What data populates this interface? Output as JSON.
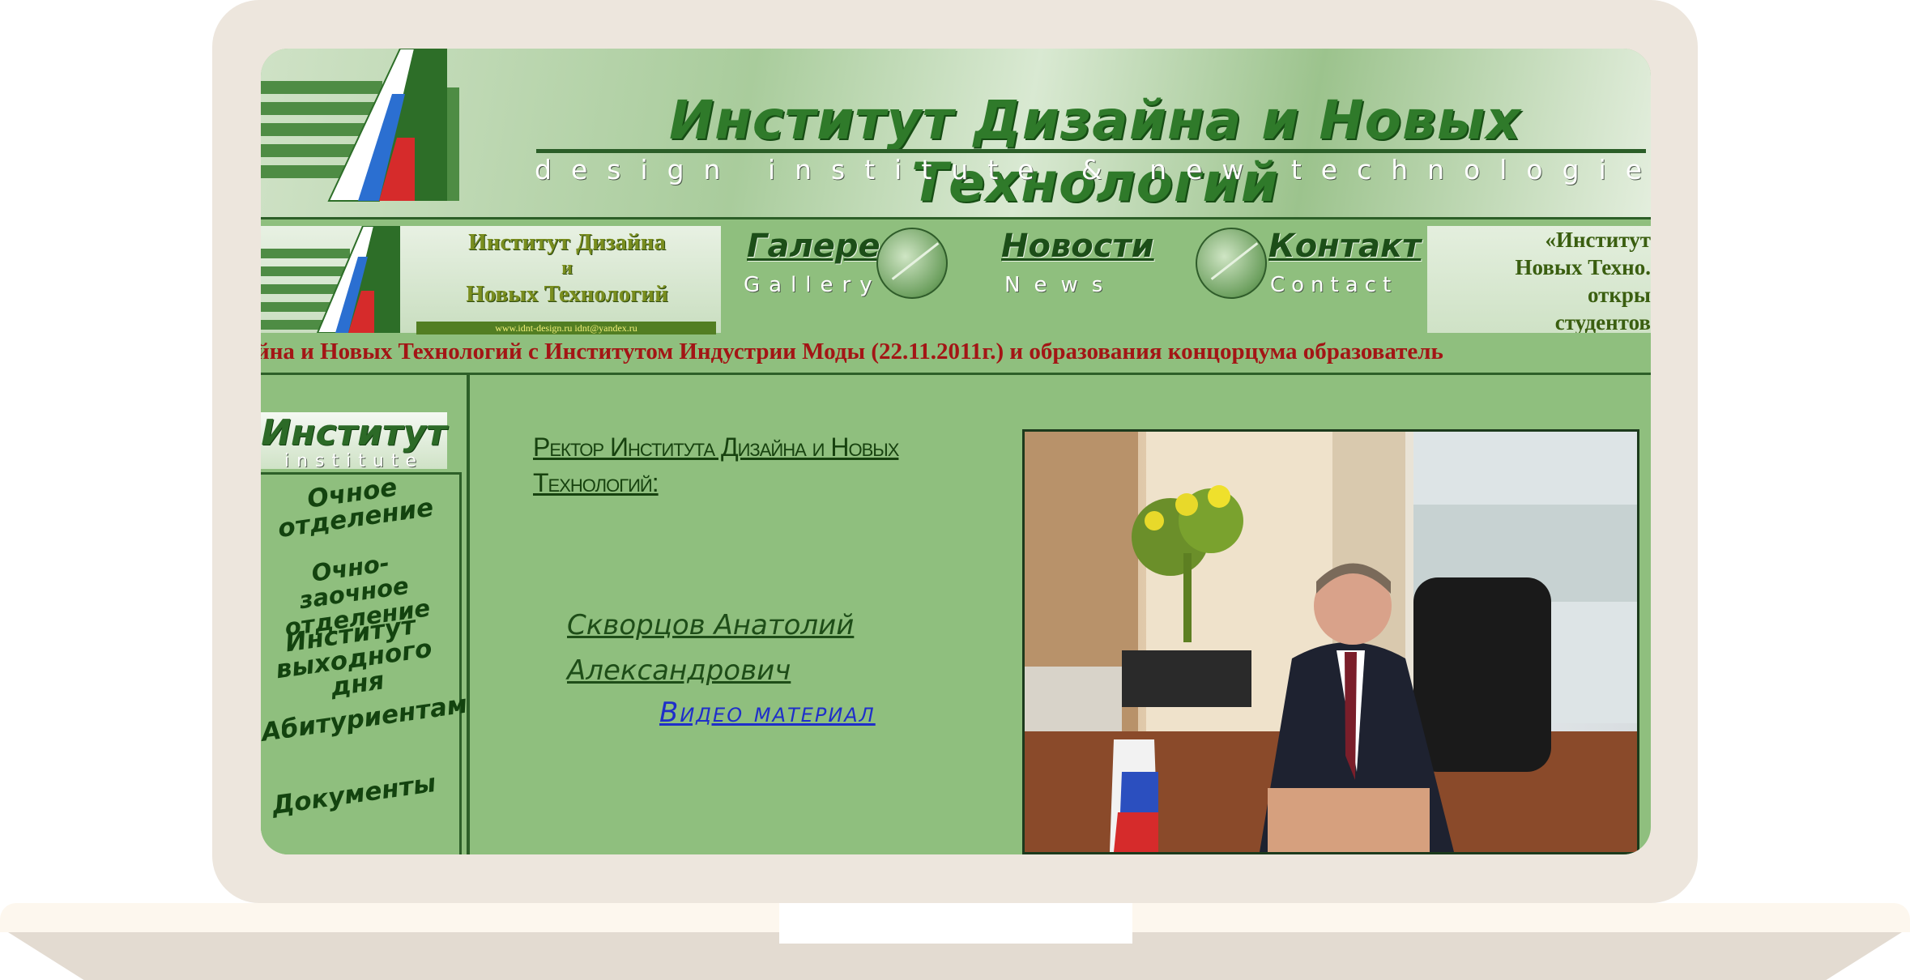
{
  "banner": {
    "title": "Институт Дизайна и Новых Технологий",
    "subtitle": "design institute & new technologies"
  },
  "nav_logo": {
    "line1": "Институт Дизайна",
    "line2": "и",
    "line3": "Новых Технологий",
    "url": "www.idnt-design.ru   idnt@yandex.ru"
  },
  "nav": [
    {
      "label": "Галерея",
      "sub": "Gallery"
    },
    {
      "label": "Новости",
      "sub": "News"
    },
    {
      "label": "Контакт",
      "sub": "Contact"
    }
  ],
  "announcement": {
    "line1": "«Институт",
    "line2": "Новых Техно.",
    "line3": "откры",
    "line4": "студентов"
  },
  "marquee": "йна и Новых Технологий с Институтом Индустрии Моды (22.11.2011г.) и образования концорцума образователь",
  "sidebar": {
    "title": "Институт",
    "subtitle": "institute",
    "items": [
      {
        "label_1": "Очное",
        "label_2": "отделение"
      },
      {
        "label_1": "Очно-заочное",
        "label_2": "отделение"
      },
      {
        "label_1": "Институт",
        "label_2": "выходного дня"
      },
      {
        "label_1": "Абитуриентам",
        "label_2": ""
      },
      {
        "label_1": "Документы",
        "label_2": ""
      }
    ]
  },
  "content": {
    "rector_title": "Ректор Института Дизайна и Новых Технологий:",
    "rector_first": "Скворцов Анатолий",
    "rector_second": "Александрович",
    "video_link": "Видео материал"
  },
  "colors": {
    "page_green": "#8fbf7e",
    "dark_green": "#2d5f28",
    "marquee_red": "#a31515",
    "link_blue": "#1f2fc9"
  }
}
